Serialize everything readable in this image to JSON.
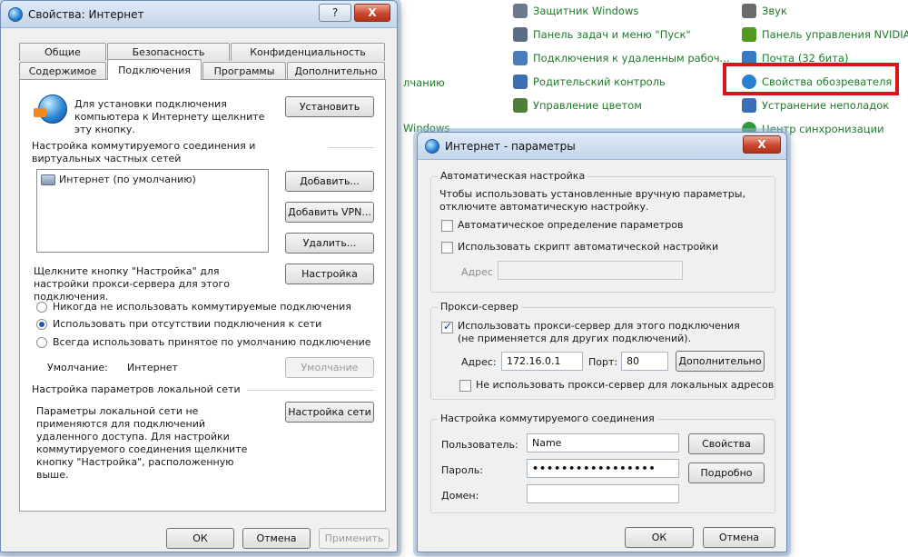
{
  "control_panel": {
    "items": [
      {
        "label": "Защитник Windows",
        "icon": "shield-icon",
        "color": "#6b7a8f"
      },
      {
        "label": "Панель задач и меню \"Пуск\"",
        "icon": "taskbar-icon",
        "color": "#5a6d84"
      },
      {
        "label": "Подключения к удаленным рабоч...",
        "icon": "remote-desktop-icon",
        "color": "#4b7bb8"
      },
      {
        "label": "Родительский контроль",
        "icon": "parental-control-icon",
        "color": "#3b6fb0"
      },
      {
        "label": "Управление цветом",
        "icon": "color-management-icon",
        "color": "#4d7f3a"
      },
      {
        "label": "Звук",
        "icon": "speaker-icon",
        "color": "#6c6c6c"
      },
      {
        "label": "Панель управления NVIDIA",
        "icon": "nvidia-icon",
        "color": "#4f9a1f"
      },
      {
        "label": "Почта (32 бита)",
        "icon": "mail-icon",
        "color": "#3a78c3"
      },
      {
        "label": "Свойства обозревателя",
        "icon": "internet-options-icon",
        "color": "#2a7fd0"
      },
      {
        "label": "Устранение неполадок",
        "icon": "troubleshoot-icon",
        "color": "#3a70b8"
      },
      {
        "label": "Центр синхронизации",
        "icon": "sync-center-icon",
        "color": "#2f9a3a"
      }
    ],
    "partial_left": "лчанию",
    "partial_windows": "Windows"
  },
  "internet_properties": {
    "title": "Свойства: Интернет",
    "help": "?",
    "close": "X",
    "tabs_top": [
      "Общие",
      "Безопасность",
      "Конфиденциальность"
    ],
    "tabs_bottom": [
      "Содержимое",
      "Подключения",
      "Программы",
      "Дополнительно"
    ],
    "setup_text": "Для установки подключения компьютера к Интернету щелкните эту кнопку.",
    "setup_button": "Установить",
    "dialup_header": "Настройка коммутируемого соединения и виртуальных частных сетей",
    "connection_item": "Интернет (по умолчанию)",
    "add_button": "Добавить...",
    "add_vpn_button": "Добавить VPN...",
    "remove_button": "Удалить...",
    "settings_text": "Щелкните кнопку \"Настройка\" для настройки прокси-сервера для этого подключения.",
    "settings_button": "Настройка",
    "radio_never": "Никогда не использовать коммутируемые подключения",
    "radio_when_no_net": "Использовать при отсутствии подключения к сети",
    "radio_always": "Всегда использовать принятое по умолчанию подключение",
    "default_label": "Умолчание:",
    "default_value": "Интернет",
    "default_button": "Умолчание",
    "lan_header": "Настройка параметров локальной сети",
    "lan_text": "Параметры локальной сети не применяются для подключений удаленного доступа. Для настройки коммутируемого соединения щелкните кнопку \"Настройка\", расположенную выше.",
    "lan_button": "Настройка сети",
    "ok": "ОК",
    "cancel": "Отмена",
    "apply": "Применить"
  },
  "internet_settings": {
    "title": "Интернет - параметры",
    "close": "X",
    "auto_group": "Автоматическая настройка",
    "auto_text": "Чтобы использовать установленные вручную параметры, отключите автоматическую настройку.",
    "auto_detect": "Автоматическое определение параметров",
    "auto_script": "Использовать скрипт автоматической настройки",
    "address_label": "Адрес",
    "proxy_group": "Прокси-сервер",
    "use_proxy": "Использовать прокси-сервер для этого подключения (не применяется для других подключений).",
    "proxy_address_label": "Адрес:",
    "proxy_address": "172.16.0.1",
    "port_label": "Порт:",
    "port": "80",
    "advanced_button": "Дополнительно",
    "bypass_local": "Не использовать прокси-сервер для локальных адресов",
    "dialup_group": "Настройка коммутируемого соединения",
    "user_label": "Пользователь:",
    "user_value": "Name",
    "password_label": "Пароль:",
    "password_value": "•••••••••••••••••",
    "domain_label": "Домен:",
    "properties_button": "Свойства",
    "details_button": "Подробно",
    "ok": "ОК",
    "cancel": "Отмена"
  }
}
